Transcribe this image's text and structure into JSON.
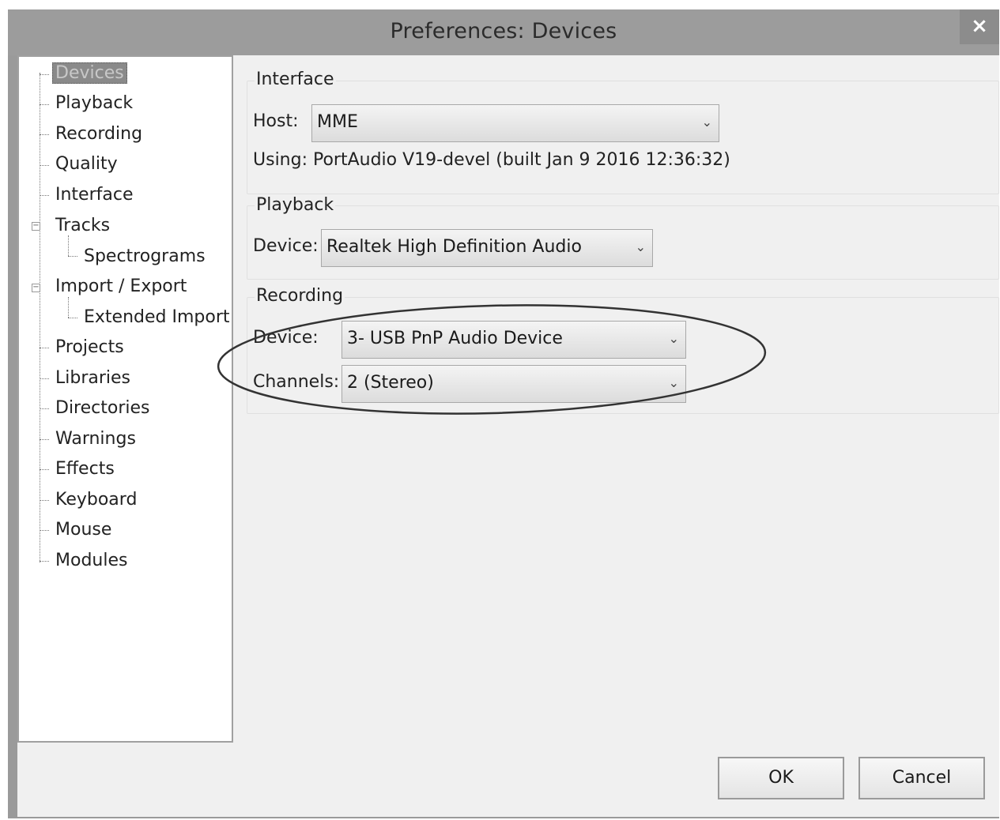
{
  "window": {
    "title": "Preferences: Devices",
    "close_glyph": "×"
  },
  "tree": {
    "items": [
      {
        "label": "Devices",
        "selected": true
      },
      {
        "label": "Playback"
      },
      {
        "label": "Recording"
      },
      {
        "label": "Quality"
      },
      {
        "label": "Interface"
      },
      {
        "label": "Tracks",
        "expandable": true
      },
      {
        "label": "Spectrograms",
        "child": true
      },
      {
        "label": "Import / Export",
        "expandable": true
      },
      {
        "label": "Extended Import",
        "child": true
      },
      {
        "label": "Projects"
      },
      {
        "label": "Libraries"
      },
      {
        "label": "Directories"
      },
      {
        "label": "Warnings"
      },
      {
        "label": "Effects"
      },
      {
        "label": "Keyboard"
      },
      {
        "label": "Mouse"
      },
      {
        "label": "Modules"
      }
    ]
  },
  "interface": {
    "group_label": "Interface",
    "host_label": "Host:",
    "host_value": "MME",
    "using_text": "Using: PortAudio V19-devel (built Jan  9 2016 12:36:32)"
  },
  "playback": {
    "group_label": "Playback",
    "device_label": "Device:",
    "device_value": "Realtek High Definition Audio"
  },
  "recording": {
    "group_label": "Recording",
    "device_label": "Device:",
    "device_value": "3- USB PnP Audio Device",
    "channels_label": "Channels:",
    "channels_value": "2 (Stereo)"
  },
  "buttons": {
    "ok_label": "OK",
    "cancel_label": "Cancel"
  },
  "icons": {
    "combo_chevron": "chevron-down-icon",
    "chevron_glyph": "⌄",
    "tree_expander": "collapse-icon",
    "expander_glyph": "−"
  }
}
